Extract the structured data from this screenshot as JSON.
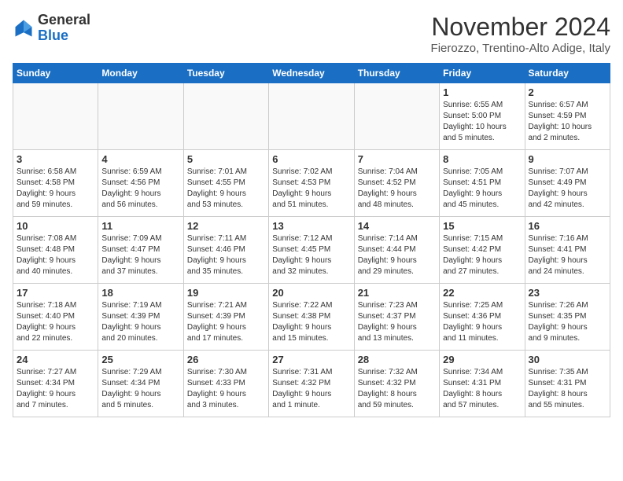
{
  "logo": {
    "general": "General",
    "blue": "Blue"
  },
  "title": "November 2024",
  "location": "Fierozzo, Trentino-Alto Adige, Italy",
  "weekdays": [
    "Sunday",
    "Monday",
    "Tuesday",
    "Wednesday",
    "Thursday",
    "Friday",
    "Saturday"
  ],
  "weeks": [
    [
      {
        "day": "",
        "info": ""
      },
      {
        "day": "",
        "info": ""
      },
      {
        "day": "",
        "info": ""
      },
      {
        "day": "",
        "info": ""
      },
      {
        "day": "",
        "info": ""
      },
      {
        "day": "1",
        "info": "Sunrise: 6:55 AM\nSunset: 5:00 PM\nDaylight: 10 hours\nand 5 minutes."
      },
      {
        "day": "2",
        "info": "Sunrise: 6:57 AM\nSunset: 4:59 PM\nDaylight: 10 hours\nand 2 minutes."
      }
    ],
    [
      {
        "day": "3",
        "info": "Sunrise: 6:58 AM\nSunset: 4:58 PM\nDaylight: 9 hours\nand 59 minutes."
      },
      {
        "day": "4",
        "info": "Sunrise: 6:59 AM\nSunset: 4:56 PM\nDaylight: 9 hours\nand 56 minutes."
      },
      {
        "day": "5",
        "info": "Sunrise: 7:01 AM\nSunset: 4:55 PM\nDaylight: 9 hours\nand 53 minutes."
      },
      {
        "day": "6",
        "info": "Sunrise: 7:02 AM\nSunset: 4:53 PM\nDaylight: 9 hours\nand 51 minutes."
      },
      {
        "day": "7",
        "info": "Sunrise: 7:04 AM\nSunset: 4:52 PM\nDaylight: 9 hours\nand 48 minutes."
      },
      {
        "day": "8",
        "info": "Sunrise: 7:05 AM\nSunset: 4:51 PM\nDaylight: 9 hours\nand 45 minutes."
      },
      {
        "day": "9",
        "info": "Sunrise: 7:07 AM\nSunset: 4:49 PM\nDaylight: 9 hours\nand 42 minutes."
      }
    ],
    [
      {
        "day": "10",
        "info": "Sunrise: 7:08 AM\nSunset: 4:48 PM\nDaylight: 9 hours\nand 40 minutes."
      },
      {
        "day": "11",
        "info": "Sunrise: 7:09 AM\nSunset: 4:47 PM\nDaylight: 9 hours\nand 37 minutes."
      },
      {
        "day": "12",
        "info": "Sunrise: 7:11 AM\nSunset: 4:46 PM\nDaylight: 9 hours\nand 35 minutes."
      },
      {
        "day": "13",
        "info": "Sunrise: 7:12 AM\nSunset: 4:45 PM\nDaylight: 9 hours\nand 32 minutes."
      },
      {
        "day": "14",
        "info": "Sunrise: 7:14 AM\nSunset: 4:44 PM\nDaylight: 9 hours\nand 29 minutes."
      },
      {
        "day": "15",
        "info": "Sunrise: 7:15 AM\nSunset: 4:42 PM\nDaylight: 9 hours\nand 27 minutes."
      },
      {
        "day": "16",
        "info": "Sunrise: 7:16 AM\nSunset: 4:41 PM\nDaylight: 9 hours\nand 24 minutes."
      }
    ],
    [
      {
        "day": "17",
        "info": "Sunrise: 7:18 AM\nSunset: 4:40 PM\nDaylight: 9 hours\nand 22 minutes."
      },
      {
        "day": "18",
        "info": "Sunrise: 7:19 AM\nSunset: 4:39 PM\nDaylight: 9 hours\nand 20 minutes."
      },
      {
        "day": "19",
        "info": "Sunrise: 7:21 AM\nSunset: 4:39 PM\nDaylight: 9 hours\nand 17 minutes."
      },
      {
        "day": "20",
        "info": "Sunrise: 7:22 AM\nSunset: 4:38 PM\nDaylight: 9 hours\nand 15 minutes."
      },
      {
        "day": "21",
        "info": "Sunrise: 7:23 AM\nSunset: 4:37 PM\nDaylight: 9 hours\nand 13 minutes."
      },
      {
        "day": "22",
        "info": "Sunrise: 7:25 AM\nSunset: 4:36 PM\nDaylight: 9 hours\nand 11 minutes."
      },
      {
        "day": "23",
        "info": "Sunrise: 7:26 AM\nSunset: 4:35 PM\nDaylight: 9 hours\nand 9 minutes."
      }
    ],
    [
      {
        "day": "24",
        "info": "Sunrise: 7:27 AM\nSunset: 4:34 PM\nDaylight: 9 hours\nand 7 minutes."
      },
      {
        "day": "25",
        "info": "Sunrise: 7:29 AM\nSunset: 4:34 PM\nDaylight: 9 hours\nand 5 minutes."
      },
      {
        "day": "26",
        "info": "Sunrise: 7:30 AM\nSunset: 4:33 PM\nDaylight: 9 hours\nand 3 minutes."
      },
      {
        "day": "27",
        "info": "Sunrise: 7:31 AM\nSunset: 4:32 PM\nDaylight: 9 hours\nand 1 minute."
      },
      {
        "day": "28",
        "info": "Sunrise: 7:32 AM\nSunset: 4:32 PM\nDaylight: 8 hours\nand 59 minutes."
      },
      {
        "day": "29",
        "info": "Sunrise: 7:34 AM\nSunset: 4:31 PM\nDaylight: 8 hours\nand 57 minutes."
      },
      {
        "day": "30",
        "info": "Sunrise: 7:35 AM\nSunset: 4:31 PM\nDaylight: 8 hours\nand 55 minutes."
      }
    ]
  ]
}
